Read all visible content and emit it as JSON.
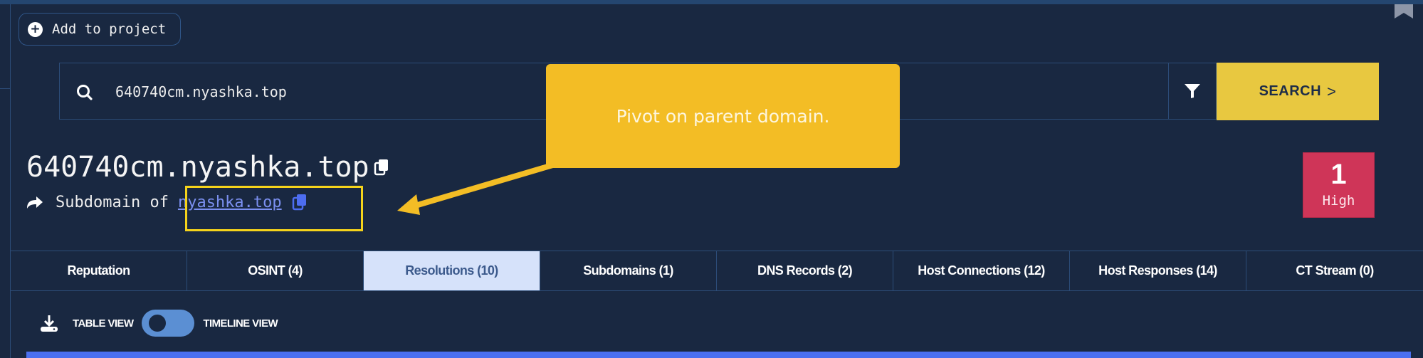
{
  "header": {
    "add_to_project_label": "Add to project"
  },
  "search": {
    "value": "640740cm.nyashka.top",
    "placeholder": "",
    "button_label": "SEARCH",
    "button_chevron": ">"
  },
  "entity": {
    "domain": "640740cm.nyashka.top",
    "subdomain_prefix": "Subdomain of",
    "parent_domain": "nyashka.top"
  },
  "risk": {
    "count": "1",
    "level": "High",
    "color": "#cf3558"
  },
  "annotation": {
    "callout_text": "Pivot on parent domain.",
    "callout_color": "#f3bd25",
    "highlight_color": "#f5d31b"
  },
  "tabs": [
    {
      "label": "Reputation",
      "active": false
    },
    {
      "label": "OSINT (4)",
      "active": false
    },
    {
      "label": "Resolutions (10)",
      "active": true
    },
    {
      "label": "Subdomains (1)",
      "active": false
    },
    {
      "label": "DNS Records (2)",
      "active": false
    },
    {
      "label": "Host Connections (12)",
      "active": false
    },
    {
      "label": "Host Responses (14)",
      "active": false
    },
    {
      "label": "CT Stream (0)",
      "active": false
    }
  ],
  "view_toggle": {
    "left_label": "TABLE VIEW",
    "right_label": "TIMELINE VIEW",
    "selected": "TABLE VIEW"
  },
  "colors": {
    "background": "#192841",
    "accent_yellow": "#e8c840",
    "link": "#7b90f0",
    "active_tab_bg": "#d6e2fa",
    "content_bar": "#4a6ff0"
  }
}
